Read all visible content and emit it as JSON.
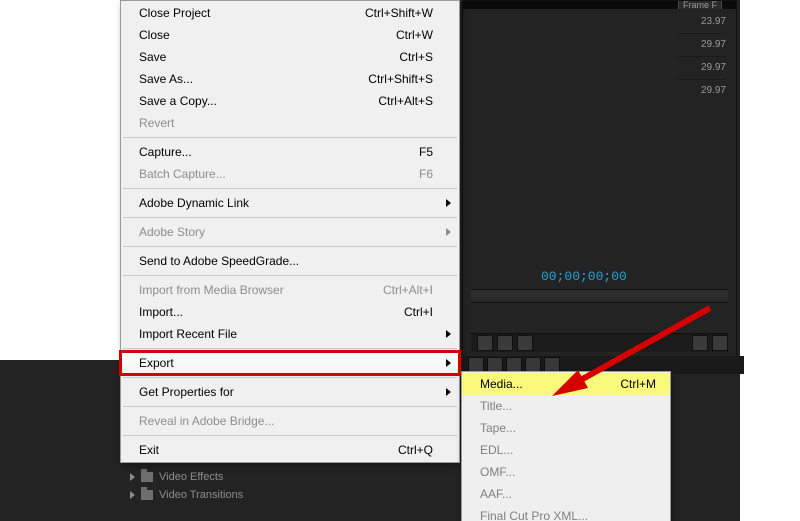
{
  "panel": {
    "frame_label": "Frame F",
    "ticks": [
      "23.97",
      "29.97",
      "29.97",
      "29.97"
    ],
    "timecode": "00;00;00;00"
  },
  "project_tree": {
    "items": [
      "Video Effects",
      "Video Transitions"
    ]
  },
  "menu": {
    "groups": [
      [
        {
          "label": "Close Project",
          "shortcut": "Ctrl+Shift+W",
          "enabled": true
        },
        {
          "label": "Close",
          "shortcut": "Ctrl+W",
          "enabled": true
        },
        {
          "label": "Save",
          "shortcut": "Ctrl+S",
          "enabled": true
        },
        {
          "label": "Save As...",
          "shortcut": "Ctrl+Shift+S",
          "enabled": true
        },
        {
          "label": "Save a Copy...",
          "shortcut": "Ctrl+Alt+S",
          "enabled": true
        },
        {
          "label": "Revert",
          "shortcut": "",
          "enabled": false
        }
      ],
      [
        {
          "label": "Capture...",
          "shortcut": "F5",
          "enabled": true
        },
        {
          "label": "Batch Capture...",
          "shortcut": "F6",
          "enabled": false
        }
      ],
      [
        {
          "label": "Adobe Dynamic Link",
          "shortcut": "",
          "enabled": true,
          "submenu": true
        }
      ],
      [
        {
          "label": "Adobe Story",
          "shortcut": "",
          "enabled": false,
          "submenu": true
        }
      ],
      [
        {
          "label": "Send to Adobe SpeedGrade...",
          "shortcut": "",
          "enabled": true
        }
      ],
      [
        {
          "label": "Import from Media Browser",
          "shortcut": "Ctrl+Alt+I",
          "enabled": false
        },
        {
          "label": "Import...",
          "shortcut": "Ctrl+I",
          "enabled": true
        },
        {
          "label": "Import Recent File",
          "shortcut": "",
          "enabled": true,
          "submenu": true
        }
      ],
      [
        {
          "label": "Export",
          "shortcut": "",
          "enabled": true,
          "submenu": true,
          "highlight": true
        }
      ],
      [
        {
          "label": "Get Properties for",
          "shortcut": "",
          "enabled": true,
          "submenu": true
        }
      ],
      [
        {
          "label": "Reveal in Adobe Bridge...",
          "shortcut": "",
          "enabled": false
        }
      ],
      [
        {
          "label": "Exit",
          "shortcut": "Ctrl+Q",
          "enabled": true
        }
      ]
    ]
  },
  "submenu": {
    "items": [
      {
        "label": "Media...",
        "shortcut": "Ctrl+M",
        "active": true
      },
      {
        "label": "Title...",
        "shortcut": "",
        "active": false
      },
      {
        "label": "Tape...",
        "shortcut": "",
        "active": false
      },
      {
        "label": "EDL...",
        "shortcut": "",
        "active": false
      },
      {
        "label": "OMF...",
        "shortcut": "",
        "active": false
      },
      {
        "label": "AAF...",
        "shortcut": "",
        "active": false
      },
      {
        "label": "Final Cut Pro XML...",
        "shortcut": "",
        "active": false
      }
    ]
  }
}
